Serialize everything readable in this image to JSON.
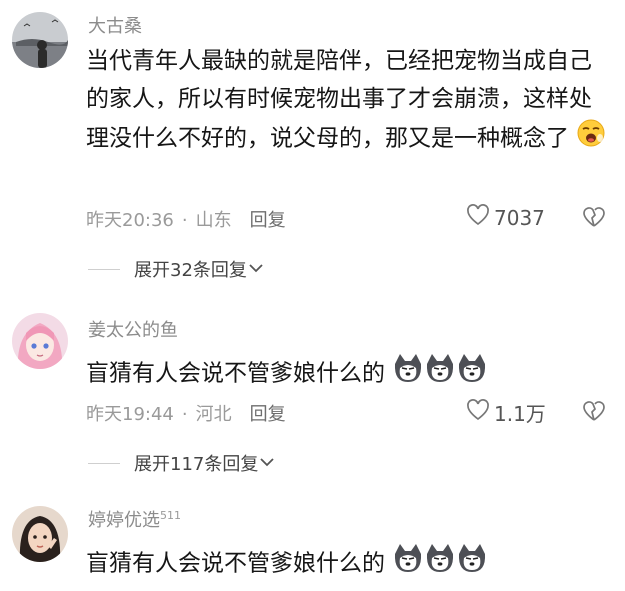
{
  "comments": [
    {
      "username": "大古桑",
      "content": "当代青年人最缺的就是陪伴，已经把宠物当成自己的家人，所以有时候宠物出事了才会崩溃，这样处理没什么不好的，说父母的，那又是一种概念了",
      "time": "昨天20:36",
      "location": "山东",
      "reply_label": "回复",
      "likes": "7037",
      "expand_label": "展开32条回复",
      "emoji": "yawning-face"
    },
    {
      "username": "姜太公的鱼",
      "content": "盲猜有人会说不管爹娘什么的",
      "time": "昨天19:44",
      "location": "河北",
      "reply_label": "回复",
      "likes": "1.1万",
      "expand_label": "展开117条回复",
      "emoji": "husky-dog-face x3"
    },
    {
      "username": "婷婷优选",
      "username_badge": "511",
      "content": "盲猜有人会说不管爹娘什么的",
      "emoji": "husky-dog-face x3"
    }
  ],
  "separator": "·"
}
